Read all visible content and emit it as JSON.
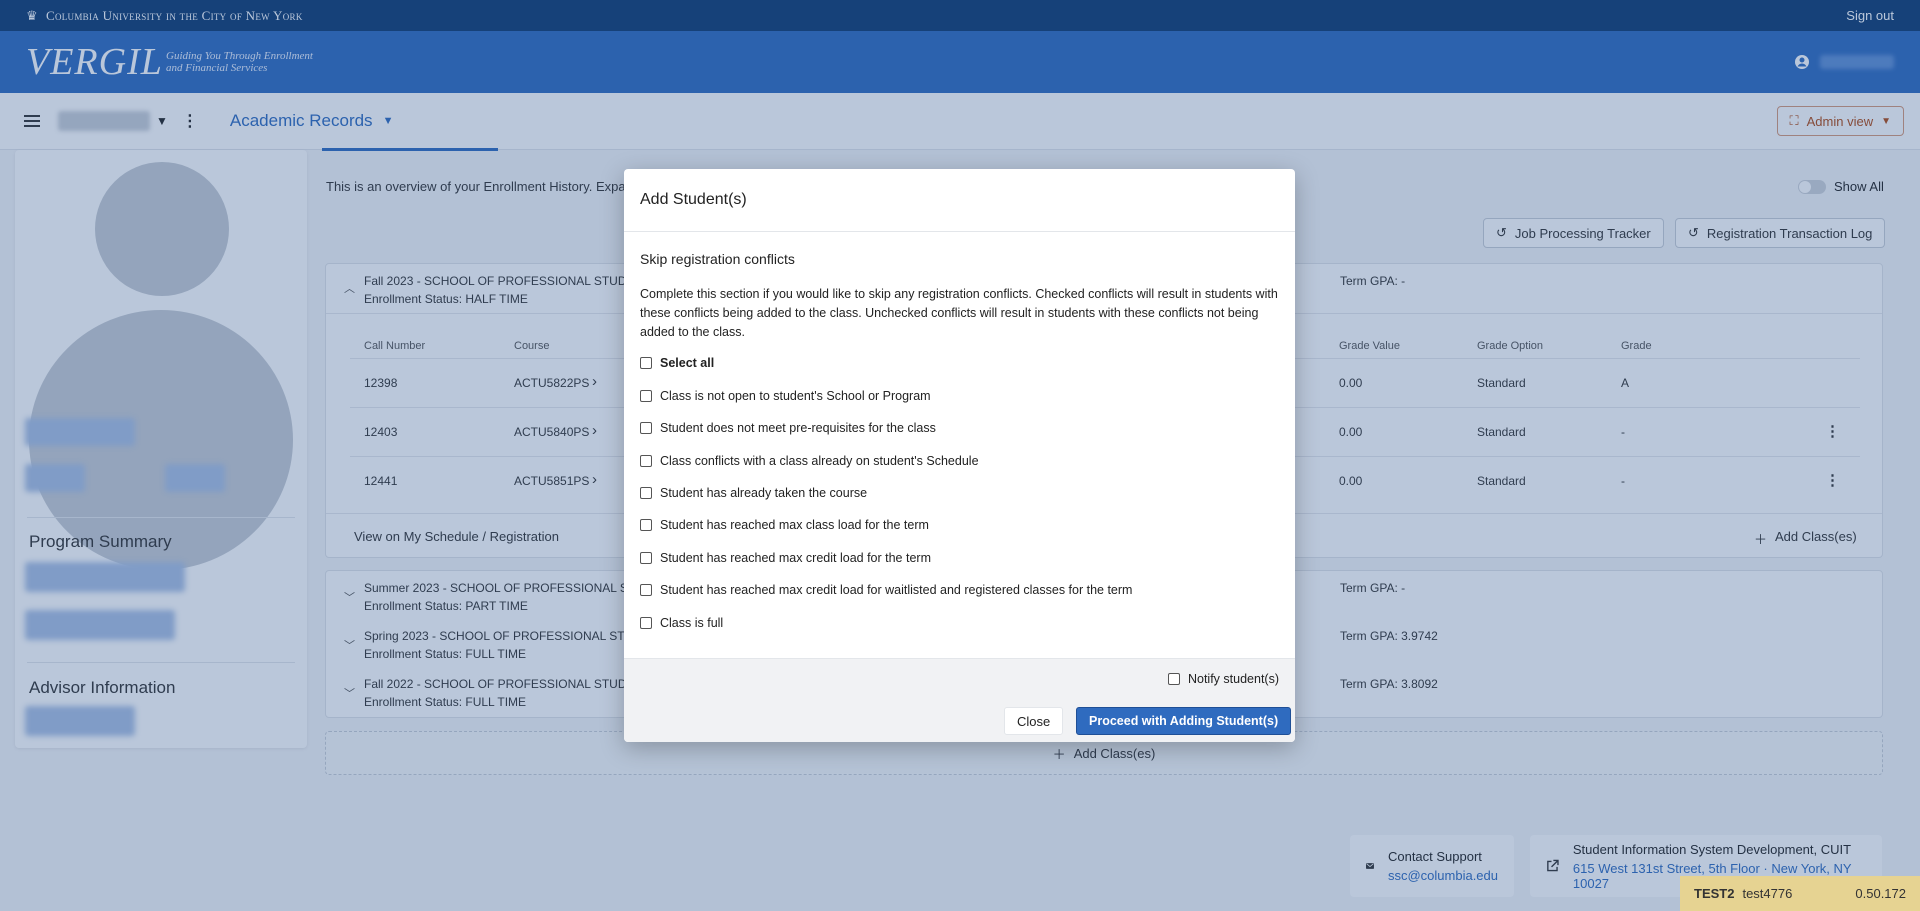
{
  "topbar": {
    "university": "Columbia University in the City of New York",
    "sign_out": "Sign out"
  },
  "brand": {
    "logo": "VERGIL",
    "tagline_1": "Guiding You Through Enrollment",
    "tagline_2": "and Financial Services"
  },
  "nav": {
    "title": "Academic Records",
    "admin_view": "Admin view"
  },
  "left": {
    "program_summary": "Program Summary",
    "advisor_information": "Advisor Information"
  },
  "main": {
    "intro": "This is an overview of your Enrollment History. Expand",
    "show_all": "Show All",
    "job_tracker": "Job Processing Tracker",
    "reg_log": "Registration Transaction Log",
    "terms": [
      {
        "title": "Fall 2023 - SCHOOL OF PROFESSIONAL STUDIES",
        "status": "Enrollment Status: HALF TIME",
        "gpa": "Term GPA: -"
      },
      {
        "title": "Summer 2023 - SCHOOL OF PROFESSIONAL STU",
        "status": "Enrollment Status: PART TIME",
        "gpa": "Term GPA: -"
      },
      {
        "title": "Spring 2023 - SCHOOL OF PROFESSIONAL STUD",
        "status": "Enrollment Status: FULL TIME",
        "gpa": "Term GPA: 3.9742"
      },
      {
        "title": "Fall 2022 - SCHOOL OF PROFESSIONAL STUDIES",
        "status": "Enrollment Status: FULL TIME",
        "gpa": "Term GPA: 3.8092"
      }
    ],
    "columns": {
      "call_number": "Call Number",
      "course": "Course",
      "grade_value": "Grade Value",
      "grade_option": "Grade Option",
      "grade": "Grade"
    },
    "rows": [
      {
        "call": "12398",
        "course": "ACTU5822PS",
        "grade_value": "0.00",
        "grade_option": "Standard",
        "grade": "A"
      },
      {
        "call": "12403",
        "course": "ACTU5840PS",
        "grade_value": "0.00",
        "grade_option": "Standard",
        "grade": "-"
      },
      {
        "call": "12441",
        "course": "ACTU5851PS",
        "grade_value": "0.00",
        "grade_option": "Standard",
        "grade": "-"
      }
    ],
    "view_schedule": "View on My Schedule / Registration",
    "add_classes": "Add Class(es)",
    "add_classes_bottom": "Add Class(es)"
  },
  "modal": {
    "title": "Add Student(s)",
    "subtitle": "Skip registration conflicts",
    "description": "Complete this section if you would like to skip any registration conflicts. Checked conflicts will result in students with these conflicts being added to the class. Unchecked conflicts will result in students with these conflicts not being added to the class.",
    "select_all": "Select all",
    "options": [
      "Class is not open to student's School or Program",
      "Student does not meet pre-requisites for the class",
      "Class conflicts with a class already on student's Schedule",
      "Student has already taken the course",
      "Student has reached max class load for the term",
      "Student has reached max credit load for the term",
      "Student has reached max credit load for waitlisted and registered classes for the term",
      "Class is full"
    ],
    "notify": "Notify student(s)",
    "close": "Close",
    "proceed": "Proceed with Adding Student(s)"
  },
  "footer": {
    "contact_support": "Contact Support",
    "email": "ssc@columbia.edu",
    "sis_title": "Student Information System Development, CUIT",
    "address": "615 West 131st Street, 5th Floor · New York, NY 10027",
    "env": "TEST2",
    "user": "test4776",
    "version": "0.50.172"
  }
}
